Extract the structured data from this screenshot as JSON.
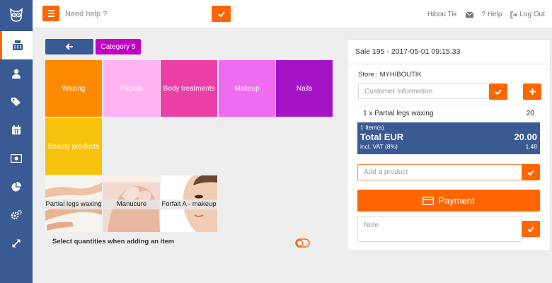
{
  "topbar": {
    "search_placeholder": "Need help ?",
    "user_name": "Hibou Tik",
    "help_label": "? Help",
    "logout_label": "Log Out"
  },
  "sidebar": {
    "items": [
      {
        "icon": "cash-register-icon",
        "active": true
      },
      {
        "icon": "user-icon",
        "active": false
      },
      {
        "icon": "tags-icon",
        "active": false
      },
      {
        "icon": "calendar-icon",
        "active": false
      },
      {
        "icon": "money-icon",
        "active": false
      },
      {
        "icon": "pie-chart-icon",
        "active": false
      },
      {
        "icon": "cogs-icon",
        "active": false
      },
      {
        "icon": "expand-icon",
        "active": false
      }
    ]
  },
  "catalog": {
    "breadcrumb_category": "Category 5",
    "categories": [
      {
        "label": "Waxing",
        "color": "#ff8a00"
      },
      {
        "label": "Facials",
        "color": "#ffb3f2"
      },
      {
        "label": "Body treatments",
        "color": "#ec3fa6"
      },
      {
        "label": "Makeup",
        "color": "#ee6cf0"
      },
      {
        "label": "Nails",
        "color": "#a314c7"
      },
      {
        "label": "Beauty products",
        "color": "#f7c20c"
      }
    ],
    "products": [
      {
        "label": "Partial legs waxing"
      },
      {
        "label": "Manucure"
      },
      {
        "label": "Forfait A - makeup"
      }
    ],
    "qty_option_label": "Select quantities when adding an item"
  },
  "sale": {
    "header": "Sale 195 - 2017-05-01 09:15:33",
    "store": "Store : MYHIBOUTIK",
    "customer_placeholder": "Customer Information",
    "line_item": {
      "label": "1 x Partial legs waxing",
      "amount": "20"
    },
    "items_count": "1 Item(s)",
    "total_label": "Total EUR",
    "total_value": "20.00",
    "vat_label": "incl. VAT (8%)",
    "vat_value": "1.48",
    "add_product_placeholder": "Add a product",
    "payment_label": "Payment",
    "note_placeholder": "Note"
  },
  "colors": {
    "accent": "#ff6600",
    "primary": "#3a5a93",
    "breadcrumb": "#c300c3"
  }
}
